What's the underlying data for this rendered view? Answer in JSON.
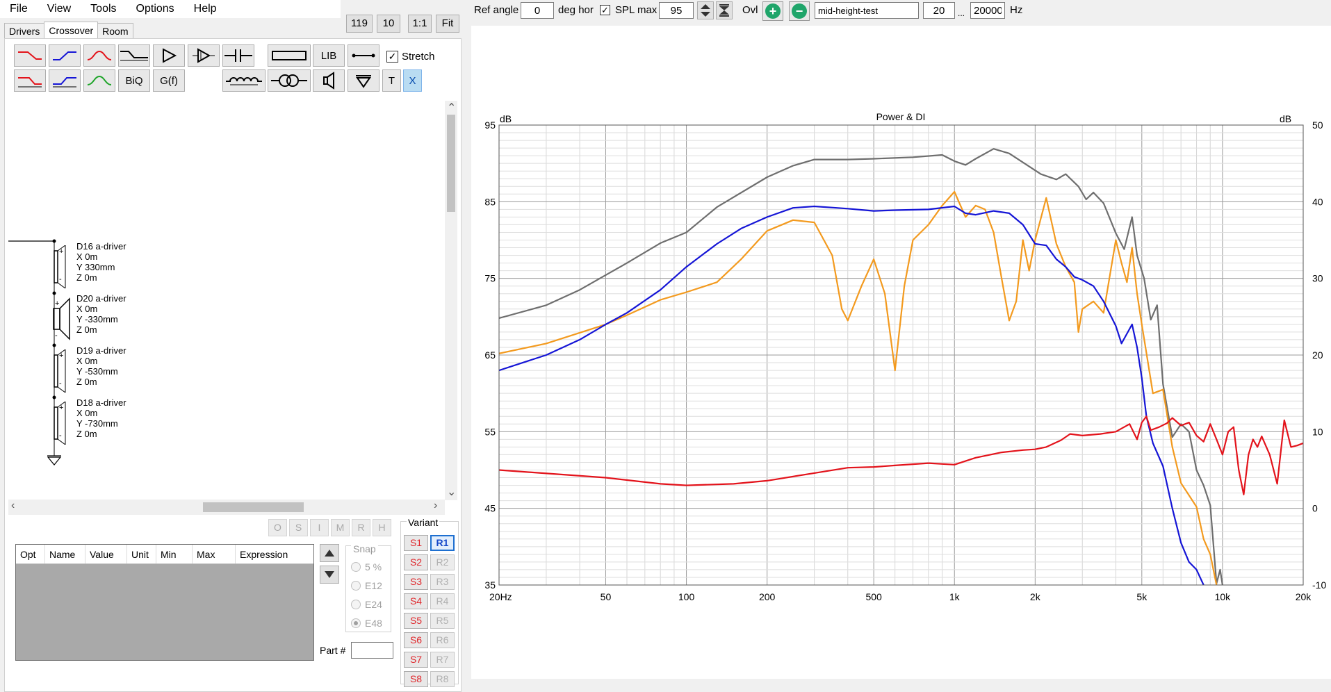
{
  "menu": [
    "File",
    "View",
    "Tools",
    "Options",
    "Help"
  ],
  "zoom_buttons": [
    "119",
    "10",
    "1:1",
    "Fit"
  ],
  "tabs": [
    {
      "label": "Drivers",
      "active": false
    },
    {
      "label": "Crossover",
      "active": true
    },
    {
      "label": "Room",
      "active": false
    }
  ],
  "toolbar": {
    "row1": [
      {
        "name": "lowpass-red-icon"
      },
      {
        "name": "highpass-blue-icon"
      },
      {
        "name": "bandpass-red-icon"
      },
      {
        "name": "shelf-icon"
      },
      {
        "name": "delay-triangle-icon"
      },
      {
        "name": "amplifier-icon"
      },
      {
        "name": "capacitor-icon"
      },
      {
        "name": "resistor-icon"
      },
      {
        "name": "library-button",
        "label": "LIB"
      },
      {
        "name": "wire-icon"
      }
    ],
    "row2": [
      {
        "name": "lowpass2-red-icon"
      },
      {
        "name": "highpass2-blue-icon"
      },
      {
        "name": "bandpass-green-icon"
      },
      {
        "name": "biquad-button",
        "label": "BiQ"
      },
      {
        "name": "gf-button",
        "label": "G(f)"
      },
      {
        "name": "inductor-icon"
      },
      {
        "name": "transformer-icon"
      },
      {
        "name": "speaker-icon"
      },
      {
        "name": "ground-icon"
      },
      {
        "name": "text-button",
        "label": "T"
      },
      {
        "name": "delete-button",
        "label": "X"
      }
    ],
    "stretch_label": "Stretch",
    "stretch_checked": true
  },
  "drivers": [
    {
      "name": "D16 a-driver",
      "x": "X 0m",
      "y": "Y 330mm",
      "z": "Z 0m"
    },
    {
      "name": "D20 a-driver",
      "x": "X 0m",
      "y": "Y -330mm",
      "z": "Z 0m"
    },
    {
      "name": "D19 a-driver",
      "x": "X 0m",
      "y": "Y -530mm",
      "z": "Z 0m"
    },
    {
      "name": "D18 a-driver",
      "x": "X 0m",
      "y": "Y -730mm",
      "z": "Z 0m"
    }
  ],
  "omni_buttons": [
    "O",
    "S",
    "I",
    "M",
    "R",
    "H"
  ],
  "opt_table": {
    "columns": [
      "Opt",
      "Name",
      "Value",
      "Unit",
      "Min",
      "Max",
      "Expression"
    ]
  },
  "snap": {
    "label": "Snap",
    "options": [
      "5 %",
      "E12",
      "E24",
      "E48"
    ],
    "selected": "E48"
  },
  "variant": {
    "label": "Variant",
    "s": [
      "S1",
      "S2",
      "S3",
      "S4",
      "S5",
      "S6",
      "S7",
      "S8"
    ],
    "r": [
      "R1",
      "R2",
      "R3",
      "R4",
      "R5",
      "R6",
      "R7",
      "R8"
    ],
    "active": "R1"
  },
  "part": {
    "label": "Part #",
    "value": ""
  },
  "topbar": {
    "ref_angle_label": "Ref angle",
    "ref_angle_value": "0",
    "deg_label": "deg hor",
    "spl_max_label": "SPL max",
    "spl_max_checked": true,
    "spl_max_value": "95",
    "ovl_label": "Ovl",
    "overlay_name": "mid-height-test",
    "freq_min": "20",
    "freq_sep": "...",
    "freq_max": "20000",
    "freq_unit": "Hz"
  },
  "colors": {
    "grey": "#6e6e6e",
    "orange": "#f39a1e",
    "blue": "#1515d6",
    "red": "#e3131b",
    "add_green": "#1fa56a"
  },
  "chart_data": {
    "type": "line",
    "title": "Power & DI",
    "ylabel": "dB",
    "y2label": "dB",
    "xscale": "log",
    "xlim": [
      20,
      20000
    ],
    "ylim": [
      35,
      95
    ],
    "y2lim": [
      -10,
      50
    ],
    "yticks": [
      35,
      45,
      55,
      65,
      75,
      85,
      95
    ],
    "y2ticks": [
      -10,
      0,
      10,
      20,
      30,
      40,
      50
    ],
    "xticks": [
      {
        "v": 20,
        "label": "20Hz"
      },
      {
        "v": 50,
        "label": "50"
      },
      {
        "v": 100,
        "label": "100"
      },
      {
        "v": 200,
        "label": "200"
      },
      {
        "v": 500,
        "label": "500"
      },
      {
        "v": 1000,
        "label": "1k"
      },
      {
        "v": 2000,
        "label": "2k"
      },
      {
        "v": 5000,
        "label": "5k"
      },
      {
        "v": 10000,
        "label": "10k"
      },
      {
        "v": 20000,
        "label": "20k"
      }
    ],
    "grid": true,
    "series": [
      {
        "color": "#6e6e6e",
        "axis": "left",
        "points": [
          [
            20,
            69.8
          ],
          [
            30,
            71.5
          ],
          [
            40,
            73.5
          ],
          [
            60,
            77
          ],
          [
            80,
            79.6
          ],
          [
            100,
            81
          ],
          [
            130,
            84.3
          ],
          [
            200,
            88.2
          ],
          [
            250,
            89.7
          ],
          [
            300,
            90.5
          ],
          [
            400,
            90.5
          ],
          [
            500,
            90.6
          ],
          [
            700,
            90.8
          ],
          [
            900,
            91.1
          ],
          [
            1000,
            90.3
          ],
          [
            1100,
            89.8
          ],
          [
            1200,
            90.6
          ],
          [
            1400,
            91.9
          ],
          [
            1600,
            91.3
          ],
          [
            1900,
            89.6
          ],
          [
            2100,
            88.6
          ],
          [
            2400,
            87.9
          ],
          [
            2600,
            88.6
          ],
          [
            2900,
            87
          ],
          [
            3100,
            85.3
          ],
          [
            3300,
            86.2
          ],
          [
            3600,
            84.8
          ],
          [
            4000,
            80.9
          ],
          [
            4300,
            78.8
          ],
          [
            4600,
            83
          ],
          [
            4800,
            78
          ],
          [
            5100,
            75
          ],
          [
            5400,
            69.6
          ],
          [
            5700,
            71.5
          ],
          [
            6000,
            61.2
          ],
          [
            6500,
            54.3
          ],
          [
            7000,
            56
          ],
          [
            7500,
            55
          ],
          [
            8000,
            50
          ],
          [
            8500,
            48
          ],
          [
            9000,
            45.4
          ],
          [
            9500,
            35.2
          ],
          [
            9800,
            37
          ],
          [
            10000,
            35
          ]
        ]
      },
      {
        "color": "#f39a1e",
        "axis": "left",
        "points": [
          [
            20,
            65.2
          ],
          [
            30,
            66.5
          ],
          [
            50,
            69
          ],
          [
            60,
            70.2
          ],
          [
            80,
            72.2
          ],
          [
            100,
            73.2
          ],
          [
            130,
            74.5
          ],
          [
            160,
            77.5
          ],
          [
            200,
            81.2
          ],
          [
            250,
            82.6
          ],
          [
            300,
            82.3
          ],
          [
            350,
            78
          ],
          [
            380,
            71
          ],
          [
            400,
            69.5
          ],
          [
            450,
            74
          ],
          [
            500,
            77.5
          ],
          [
            550,
            73
          ],
          [
            600,
            63
          ],
          [
            650,
            74
          ],
          [
            700,
            80
          ],
          [
            800,
            82
          ],
          [
            900,
            84.5
          ],
          [
            1000,
            86.3
          ],
          [
            1100,
            83
          ],
          [
            1200,
            84.5
          ],
          [
            1300,
            84
          ],
          [
            1400,
            81
          ],
          [
            1500,
            75
          ],
          [
            1600,
            69.5
          ],
          [
            1700,
            72
          ],
          [
            1800,
            80
          ],
          [
            1900,
            76
          ],
          [
            2000,
            80
          ],
          [
            2200,
            85.5
          ],
          [
            2400,
            79.5
          ],
          [
            2600,
            76.5
          ],
          [
            2800,
            74.5
          ],
          [
            2900,
            68
          ],
          [
            3000,
            71
          ],
          [
            3300,
            72
          ],
          [
            3600,
            70.5
          ],
          [
            4000,
            80
          ],
          [
            4200,
            77
          ],
          [
            4400,
            74.5
          ],
          [
            4600,
            79
          ],
          [
            4800,
            73
          ],
          [
            5000,
            69
          ],
          [
            5500,
            60
          ],
          [
            6000,
            60.5
          ],
          [
            6500,
            53
          ],
          [
            7000,
            48.3
          ],
          [
            7500,
            46.7
          ],
          [
            8000,
            45.2
          ],
          [
            8500,
            41
          ],
          [
            9000,
            39
          ],
          [
            9500,
            35
          ]
        ]
      },
      {
        "color": "#1515d6",
        "axis": "left",
        "points": [
          [
            20,
            63
          ],
          [
            30,
            65
          ],
          [
            40,
            67
          ],
          [
            50,
            69
          ],
          [
            60,
            70.5
          ],
          [
            80,
            73.5
          ],
          [
            100,
            76.5
          ],
          [
            130,
            79.5
          ],
          [
            160,
            81.5
          ],
          [
            200,
            83
          ],
          [
            250,
            84.2
          ],
          [
            300,
            84.4
          ],
          [
            400,
            84.1
          ],
          [
            500,
            83.8
          ],
          [
            600,
            83.9
          ],
          [
            800,
            84
          ],
          [
            1000,
            84.4
          ],
          [
            1100,
            83.5
          ],
          [
            1200,
            83.3
          ],
          [
            1400,
            83.8
          ],
          [
            1600,
            83.5
          ],
          [
            1800,
            82
          ],
          [
            2000,
            79.5
          ],
          [
            2200,
            79.3
          ],
          [
            2400,
            77.5
          ],
          [
            2600,
            76.5
          ],
          [
            2800,
            75.2
          ],
          [
            3000,
            74.8
          ],
          [
            3300,
            74
          ],
          [
            3600,
            72
          ],
          [
            4000,
            68.8
          ],
          [
            4200,
            66.5
          ],
          [
            4600,
            69
          ],
          [
            4800,
            66
          ],
          [
            5000,
            62
          ],
          [
            5200,
            57
          ],
          [
            5500,
            53.5
          ],
          [
            6000,
            50.5
          ],
          [
            6500,
            45
          ],
          [
            7000,
            40.5
          ],
          [
            7500,
            38
          ],
          [
            8000,
            37
          ],
          [
            8500,
            35
          ]
        ]
      },
      {
        "color": "#e3131b",
        "axis": "right",
        "points": [
          [
            20,
            5
          ],
          [
            50,
            4
          ],
          [
            80,
            3.2
          ],
          [
            100,
            3
          ],
          [
            150,
            3.2
          ],
          [
            200,
            3.6
          ],
          [
            300,
            4.6
          ],
          [
            400,
            5.3
          ],
          [
            500,
            5.4
          ],
          [
            600,
            5.6
          ],
          [
            800,
            5.9
          ],
          [
            1000,
            5.7
          ],
          [
            1200,
            6.6
          ],
          [
            1500,
            7.3
          ],
          [
            1800,
            7.6
          ],
          [
            2000,
            7.7
          ],
          [
            2200,
            8
          ],
          [
            2500,
            8.9
          ],
          [
            2700,
            9.7
          ],
          [
            3000,
            9.5
          ],
          [
            3500,
            9.7
          ],
          [
            4000,
            10
          ],
          [
            4500,
            11
          ],
          [
            4800,
            9
          ],
          [
            5000,
            11.2
          ],
          [
            5200,
            12
          ],
          [
            5400,
            10.2
          ],
          [
            5800,
            10.6
          ],
          [
            6200,
            11.1
          ],
          [
            6500,
            11.8
          ],
          [
            7000,
            10.8
          ],
          [
            7500,
            11.2
          ],
          [
            8000,
            9.5
          ],
          [
            8500,
            8.7
          ],
          [
            9000,
            11
          ],
          [
            9500,
            9
          ],
          [
            10000,
            7
          ],
          [
            10500,
            10
          ],
          [
            11000,
            10.6
          ],
          [
            11500,
            5
          ],
          [
            12000,
            1.8
          ],
          [
            12500,
            7
          ],
          [
            13000,
            9
          ],
          [
            13500,
            8
          ],
          [
            14000,
            9.4
          ],
          [
            15000,
            7
          ],
          [
            16000,
            3.2
          ],
          [
            17000,
            11.5
          ],
          [
            18000,
            8
          ],
          [
            19000,
            8.2
          ],
          [
            20000,
            8.5
          ]
        ]
      }
    ]
  }
}
